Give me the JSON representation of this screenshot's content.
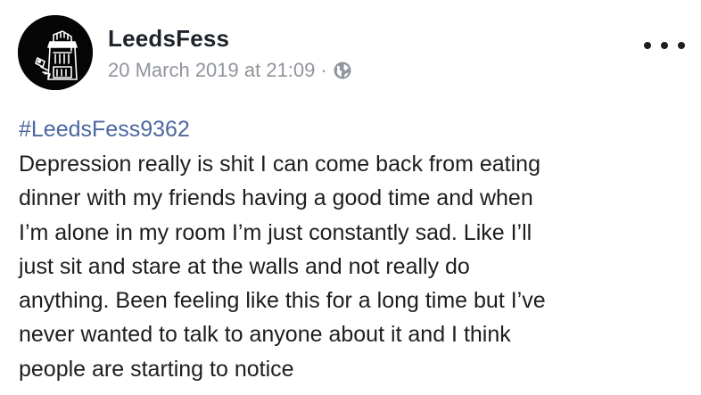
{
  "post": {
    "author": "LeedsFess",
    "timestamp": "20 March 2019 at 21:09",
    "separator": "·",
    "privacy_icon": "globe-icon",
    "menu_icon": "more-options-icon",
    "hashtag": "#LeedsFess9362",
    "body_lines": [
      "Depression really is shit I can come back from eating",
      "dinner with my friends having a good time and when",
      "I’m alone in my room I’m just constantly sad. Like I’ll",
      "just sit and stare at the walls and not really do",
      "anything. Been feeling like this for a long time but I’ve",
      "never wanted to talk to anyone about it and I think",
      "people are starting to notice"
    ]
  },
  "colors": {
    "hashtag": "#4b67a1",
    "meta": "#90949c",
    "text": "#1c1e21"
  }
}
